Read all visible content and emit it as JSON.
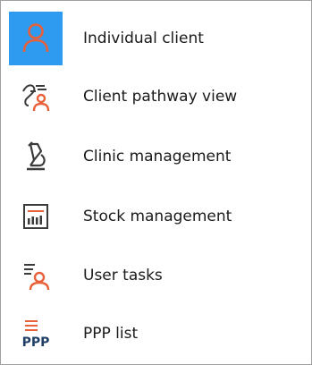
{
  "menu": {
    "items": [
      {
        "label": "Individual client",
        "icon": "person-icon",
        "selected": true
      },
      {
        "label": "Client pathway view",
        "icon": "pathway-icon",
        "selected": false
      },
      {
        "label": "Clinic management",
        "icon": "microscope-icon",
        "selected": false
      },
      {
        "label": "Stock management",
        "icon": "stock-chart-icon",
        "selected": false
      },
      {
        "label": "User tasks",
        "icon": "user-tasks-icon",
        "selected": false
      },
      {
        "label": "PPP list",
        "icon": "ppp-list-icon",
        "selected": false
      }
    ],
    "icon_text": {
      "ppp": "PPP"
    },
    "colors": {
      "selected_bg": "#2f9bf0",
      "accent_orange": "#e8613a",
      "icon_dark": "#3a3a3a"
    }
  }
}
